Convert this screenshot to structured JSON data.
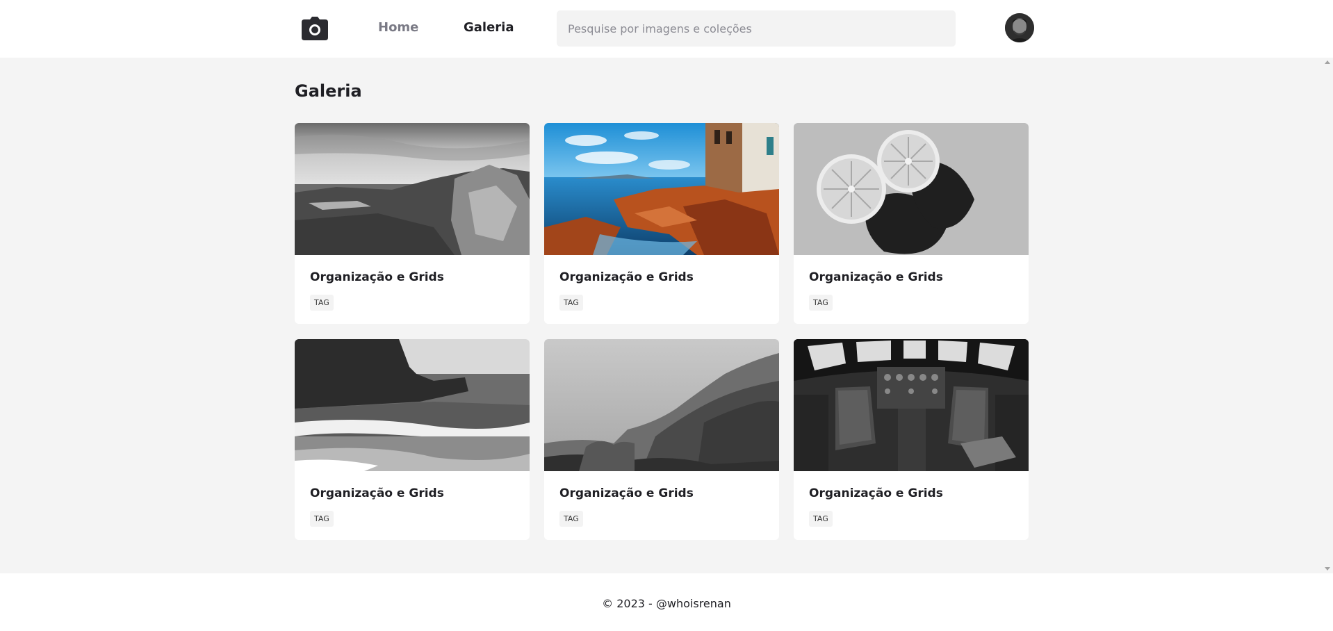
{
  "header": {
    "logo_icon": "camera-icon",
    "nav": {
      "home_label": "Home",
      "gallery_label": "Galeria"
    },
    "search": {
      "placeholder": "Pesquise por imagens e coleções",
      "value": ""
    },
    "avatar_icon": "user-avatar"
  },
  "main": {
    "title": "Galeria",
    "cards": [
      {
        "title": "Organização e Grids",
        "tag": "TAG",
        "image": "rocky-coast-bw"
      },
      {
        "title": "Organização e Grids",
        "tag": "TAG",
        "image": "coastal-rocks-color"
      },
      {
        "title": "Organização e Grids",
        "tag": "TAG",
        "image": "lemon-halves-bw"
      },
      {
        "title": "Organização e Grids",
        "tag": "TAG",
        "image": "beach-cliff-bw"
      },
      {
        "title": "Organização e Grids",
        "tag": "TAG",
        "image": "foggy-forest-bw"
      },
      {
        "title": "Organização e Grids",
        "tag": "TAG",
        "image": "airplane-cockpit-bw"
      }
    ]
  },
  "footer": {
    "text": "© 2023 - @whoisrenan"
  },
  "colors": {
    "page_background": "#f4f4f4",
    "surface": "#ffffff",
    "text_primary": "#1f1f24",
    "text_muted": "#7a7a85",
    "input_background": "#f3f3f3"
  }
}
